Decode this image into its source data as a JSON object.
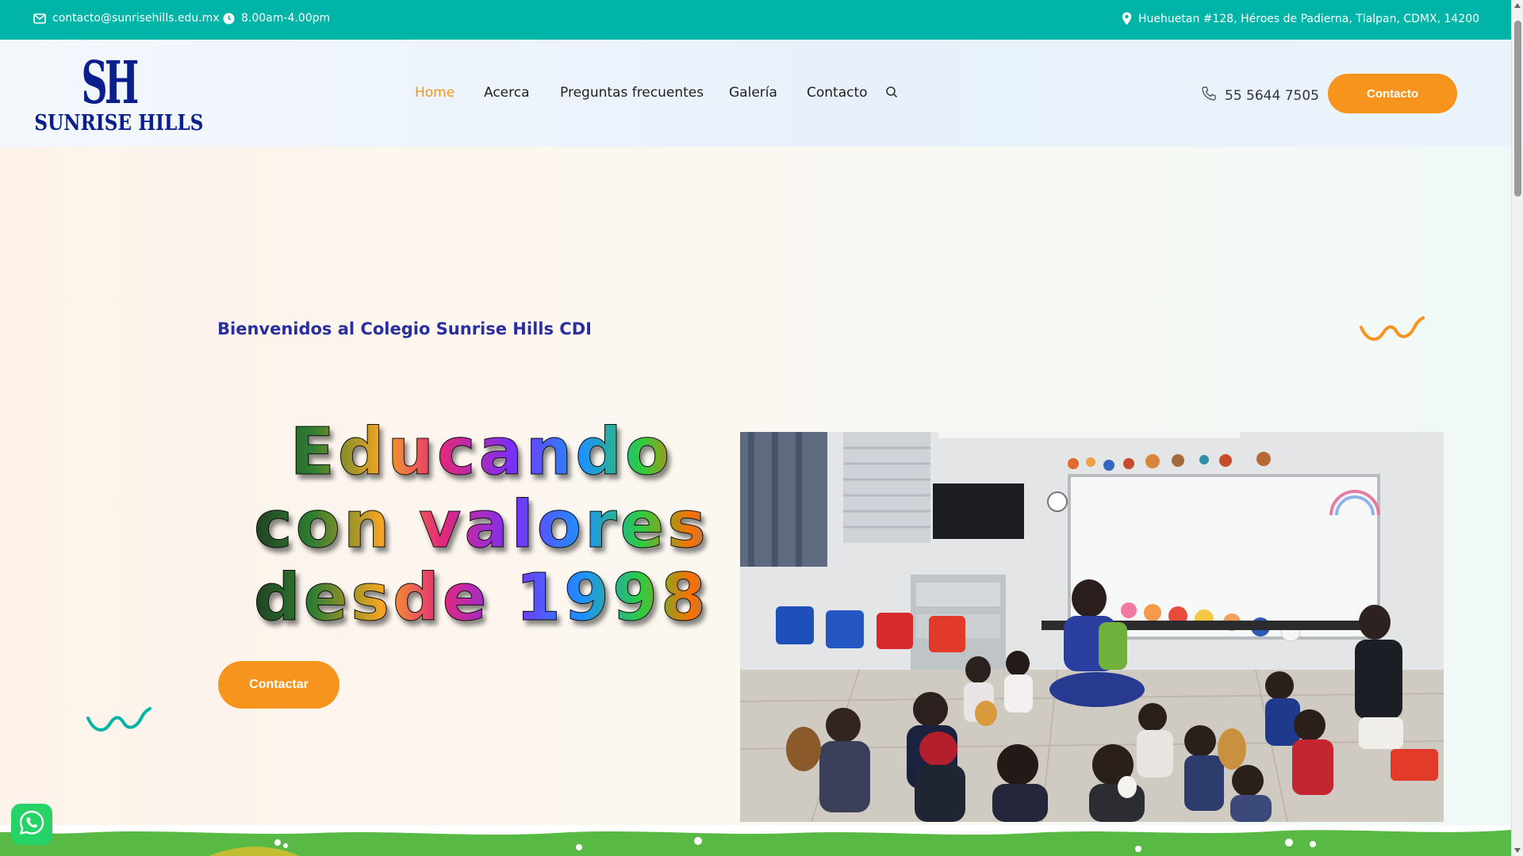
{
  "topbar": {
    "email": "contacto@sunrisehills.edu.mx",
    "hours": "8.00am-4.00pm",
    "address": "Huehuetan #128, Héroes de Padierna, Tlalpan, CDMX, 14200"
  },
  "logo": {
    "monogram": "SH",
    "wordmark": "SUNRISE HILLS"
  },
  "nav": {
    "items": [
      {
        "label": "Home",
        "active": true
      },
      {
        "label": "Acerca",
        "active": false
      },
      {
        "label": "Preguntas frecuentes",
        "active": false
      },
      {
        "label": "Galería",
        "active": false
      },
      {
        "label": "Contacto",
        "active": false
      }
    ]
  },
  "header": {
    "phone": "55 5644 7505",
    "cta_label": "Contacto"
  },
  "hero": {
    "welcome": "Bienvenidos al Colegio Sunrise Hills CDI",
    "headline": "Educando con valores desde 1998",
    "cta_label": "Contactar"
  },
  "icons": {
    "email": "envelope-icon",
    "clock": "clock-icon",
    "location": "map-pin-icon",
    "search": "search-icon",
    "phone": "phone-icon",
    "whatsapp": "whatsapp-icon"
  },
  "colors": {
    "teal": "#00b4a8",
    "orange": "#f7941d",
    "navy": "#2a2f9e",
    "nav_text": "#1f1f1f"
  }
}
